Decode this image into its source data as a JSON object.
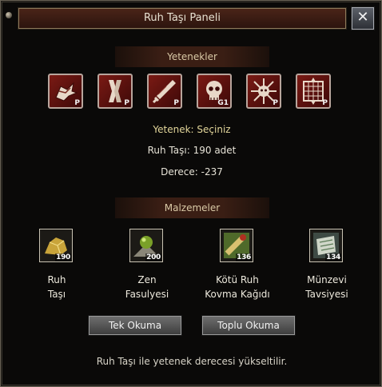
{
  "window": {
    "title": "Ruh Taşı Paneli",
    "close_label": "✕"
  },
  "skills_section": {
    "title": "Yetenekler"
  },
  "skills": [
    {
      "icon": "dragon-icon",
      "tag": "P"
    },
    {
      "icon": "twisted-blade-icon",
      "tag": "P"
    },
    {
      "icon": "sword-icon",
      "tag": "P"
    },
    {
      "icon": "skull-icon",
      "tag": "G1"
    },
    {
      "icon": "radiant-creature-icon",
      "tag": "P"
    },
    {
      "icon": "rune-grid-icon",
      "tag": "P"
    }
  ],
  "info": {
    "skill_label": "Yetenek:",
    "skill_value": "Seçiniz",
    "stone_label": "Ruh Taşı:",
    "stone_value": "190 adet",
    "degree_label": "Derece:",
    "degree_value": "-237"
  },
  "materials_section": {
    "title": "Malzemeler"
  },
  "materials": [
    {
      "icon": "gold-ore-icon",
      "count": "190",
      "line1": "Ruh",
      "line2": "Taşı"
    },
    {
      "icon": "green-bean-icon",
      "count": "200",
      "line1": "Zen",
      "line2": "Fasulyesi"
    },
    {
      "icon": "scroll-icon",
      "count": "136",
      "line1": "Kötü Ruh",
      "line2": "Kovma Kağıdı"
    },
    {
      "icon": "book-icon",
      "count": "134",
      "line1": "Münzevi",
      "line2": "Tavsiyesi"
    }
  ],
  "buttons": {
    "single": "Tek Okuma",
    "bulk": "Toplu Okuma"
  },
  "footer": "Ruh Taşı ile yetenek derecesi yükseltilir."
}
